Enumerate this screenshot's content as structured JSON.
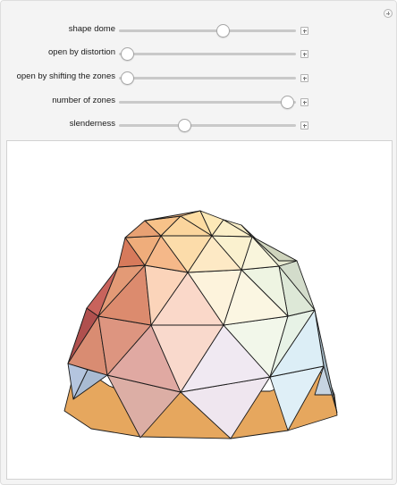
{
  "controls": [
    {
      "id": "shape-dome",
      "label": "shape dome",
      "value": 0.59
    },
    {
      "id": "open-by-distortion",
      "label": "open by distortion",
      "value": 0.05
    },
    {
      "id": "open-by-shifting-zones",
      "label": "open by shifting the zones",
      "value": 0.05
    },
    {
      "id": "number-of-zones",
      "label": "number of zones",
      "value": 0.95
    },
    {
      "id": "slenderness",
      "label": "slenderness",
      "value": 0.37
    }
  ],
  "colors": {
    "panel_bg": "#f4f4f4",
    "graphic_bg": "#ffffff",
    "base_ring": "#e6a75e",
    "edge": "#1a1a1a"
  },
  "graphic": {
    "content": "geodesic dome 3D plot"
  }
}
